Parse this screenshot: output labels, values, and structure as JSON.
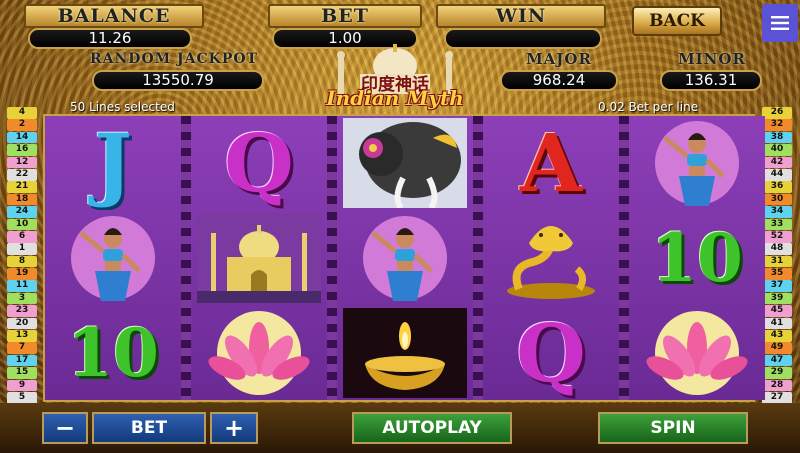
{
  "meters": {
    "balance_label": "BALANCE",
    "balance_value": "11.26",
    "bet_label": "BET",
    "bet_value": "1.00",
    "win_label": "WIN",
    "win_value": ""
  },
  "jackpots": {
    "random_label": "RANDOM JACKPOT",
    "random_value": "13550.79",
    "major_label": "MAJOR",
    "major_value": "968.24",
    "minor_label": "MINOR",
    "minor_value": "136.31"
  },
  "back_label": "BACK",
  "menu_icon": "hamburger-menu-icon",
  "logo": {
    "chinese": "印度神话",
    "english": "Indian Myth"
  },
  "lines_selected": "50 Lines selected",
  "bet_per_line": "0.02 Bet per line",
  "left_lines": [
    "4",
    "2",
    "14",
    "16",
    "12",
    "22",
    "21",
    "18",
    "24",
    "10",
    "6",
    "1",
    "8",
    "19",
    "11",
    "3",
    "23",
    "20",
    "13",
    "7",
    "17",
    "15",
    "9",
    "5"
  ],
  "right_lines": [
    "26",
    "32",
    "38",
    "40",
    "42",
    "44",
    "36",
    "30",
    "34",
    "33",
    "52",
    "48",
    "31",
    "35",
    "37",
    "39",
    "45",
    "41",
    "43",
    "49",
    "47",
    "29",
    "28",
    "27"
  ],
  "line_colors": [
    "#e8d23a",
    "#f08a2a",
    "#5fd2f0",
    "#a0e060",
    "#f0a0d0",
    "#e0e0e0"
  ],
  "reels": [
    [
      "J",
      "dancer",
      "10"
    ],
    [
      "Q",
      "taj-mahal",
      "lotus"
    ],
    [
      "elephant",
      "dancer",
      "diya-lamp"
    ],
    [
      "A",
      "cobra",
      "Q"
    ],
    [
      "dancer",
      "10",
      "lotus"
    ]
  ],
  "controls": {
    "minus": "−",
    "bet": "BET",
    "plus": "+",
    "autoplay": "AUTOPLAY",
    "spin": "SPIN"
  }
}
